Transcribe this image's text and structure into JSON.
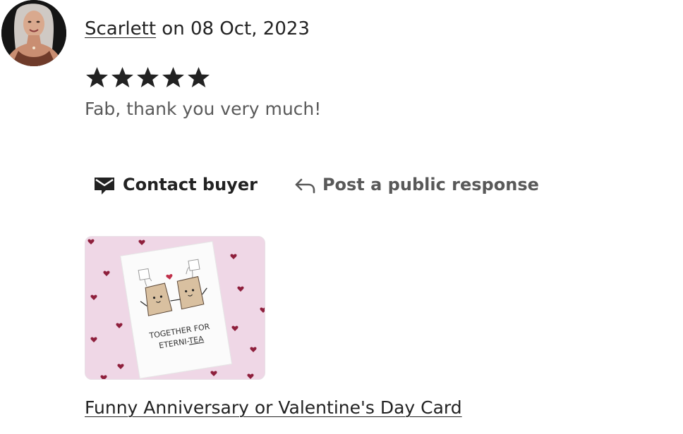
{
  "review": {
    "reviewer_name": "Scarlett",
    "date_text": " on 08 Oct, 2023",
    "rating": 5,
    "rating_max": 5,
    "text": "Fab, thank you very much!",
    "star_color": "#222222"
  },
  "actions": {
    "contact_label": "Contact buyer",
    "contact_icon": "envelope-icon",
    "respond_label": "Post a public response",
    "respond_icon": "reply-arrow-icon"
  },
  "listing": {
    "card_text_line1": "TOGETHER FOR",
    "card_text_line2_prefix": "ETERNI-",
    "card_text_line2_emph": "TEA",
    "title": "Funny Anniversary or Valentine's Day Card",
    "background_color": "#efd7e6",
    "heart_color": "#8e1f3c"
  }
}
